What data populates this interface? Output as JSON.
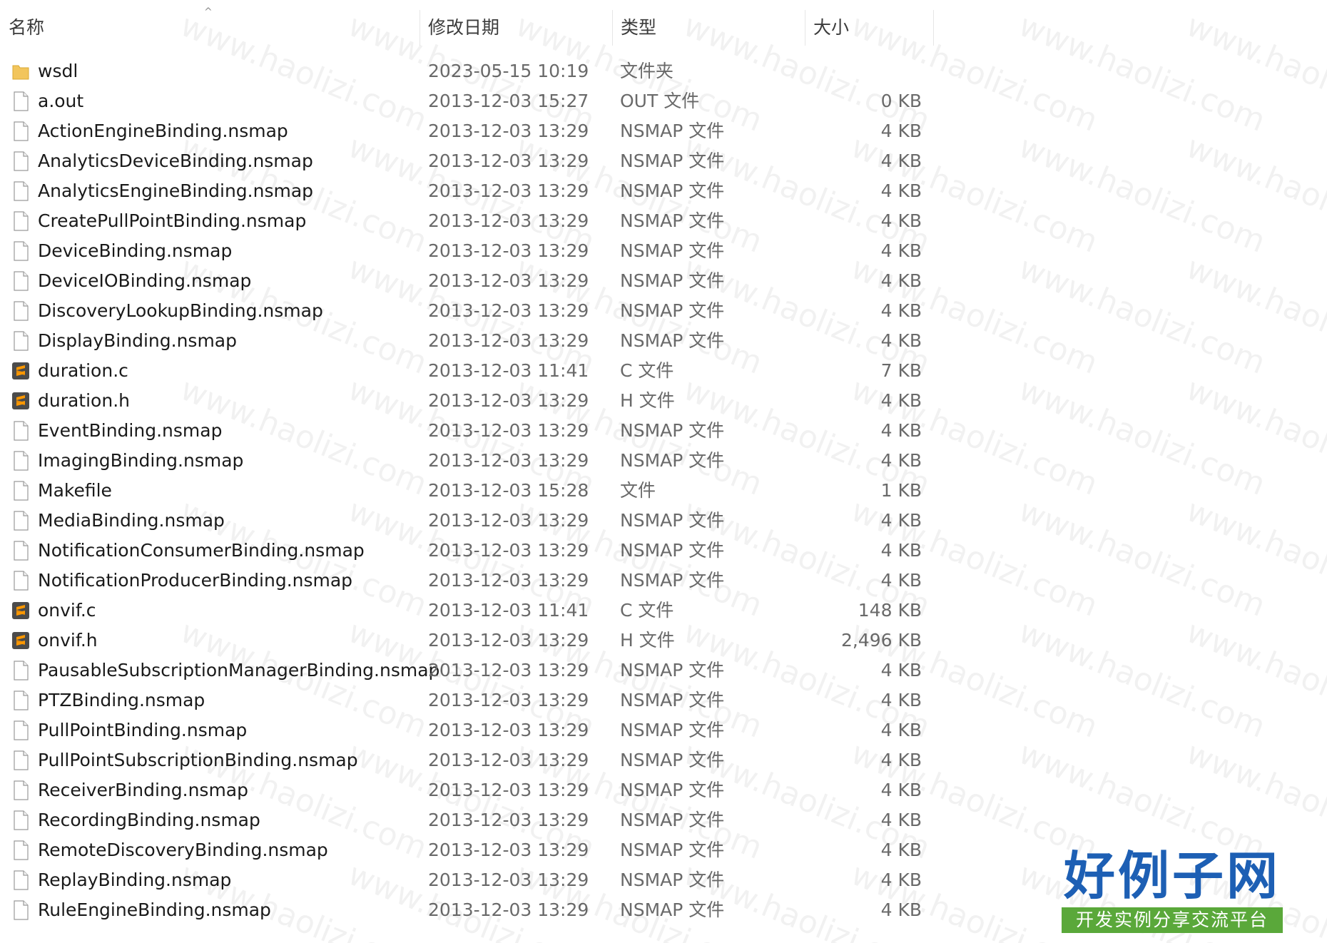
{
  "columns": {
    "name": "名称",
    "modified": "修改日期",
    "type": "类型",
    "size": "大小"
  },
  "files": [
    {
      "name": "wsdl",
      "date": "2023-05-15 10:19",
      "type": "文件夹",
      "size": "",
      "icon": "folder-icon"
    },
    {
      "name": "a.out",
      "date": "2013-12-03 15:27",
      "type": "OUT 文件",
      "size": "0 KB",
      "icon": "file-icon"
    },
    {
      "name": "ActionEngineBinding.nsmap",
      "date": "2013-12-03 13:29",
      "type": "NSMAP 文件",
      "size": "4 KB",
      "icon": "file-icon"
    },
    {
      "name": "AnalyticsDeviceBinding.nsmap",
      "date": "2013-12-03 13:29",
      "type": "NSMAP 文件",
      "size": "4 KB",
      "icon": "file-icon"
    },
    {
      "name": "AnalyticsEngineBinding.nsmap",
      "date": "2013-12-03 13:29",
      "type": "NSMAP 文件",
      "size": "4 KB",
      "icon": "file-icon"
    },
    {
      "name": "CreatePullPointBinding.nsmap",
      "date": "2013-12-03 13:29",
      "type": "NSMAP 文件",
      "size": "4 KB",
      "icon": "file-icon"
    },
    {
      "name": "DeviceBinding.nsmap",
      "date": "2013-12-03 13:29",
      "type": "NSMAP 文件",
      "size": "4 KB",
      "icon": "file-icon"
    },
    {
      "name": "DeviceIOBinding.nsmap",
      "date": "2013-12-03 13:29",
      "type": "NSMAP 文件",
      "size": "4 KB",
      "icon": "file-icon"
    },
    {
      "name": "DiscoveryLookupBinding.nsmap",
      "date": "2013-12-03 13:29",
      "type": "NSMAP 文件",
      "size": "4 KB",
      "icon": "file-icon"
    },
    {
      "name": "DisplayBinding.nsmap",
      "date": "2013-12-03 13:29",
      "type": "NSMAP 文件",
      "size": "4 KB",
      "icon": "file-icon"
    },
    {
      "name": "duration.c",
      "date": "2013-12-03 11:41",
      "type": "C 文件",
      "size": "7 KB",
      "icon": "sublime-text-icon"
    },
    {
      "name": "duration.h",
      "date": "2013-12-03 13:29",
      "type": "H 文件",
      "size": "4 KB",
      "icon": "sublime-text-icon"
    },
    {
      "name": "EventBinding.nsmap",
      "date": "2013-12-03 13:29",
      "type": "NSMAP 文件",
      "size": "4 KB",
      "icon": "file-icon"
    },
    {
      "name": "ImagingBinding.nsmap",
      "date": "2013-12-03 13:29",
      "type": "NSMAP 文件",
      "size": "4 KB",
      "icon": "file-icon"
    },
    {
      "name": "Makefile",
      "date": "2013-12-03 15:28",
      "type": "文件",
      "size": "1 KB",
      "icon": "file-icon"
    },
    {
      "name": "MediaBinding.nsmap",
      "date": "2013-12-03 13:29",
      "type": "NSMAP 文件",
      "size": "4 KB",
      "icon": "file-icon"
    },
    {
      "name": "NotificationConsumerBinding.nsmap",
      "date": "2013-12-03 13:29",
      "type": "NSMAP 文件",
      "size": "4 KB",
      "icon": "file-icon"
    },
    {
      "name": "NotificationProducerBinding.nsmap",
      "date": "2013-12-03 13:29",
      "type": "NSMAP 文件",
      "size": "4 KB",
      "icon": "file-icon"
    },
    {
      "name": "onvif.c",
      "date": "2013-12-03 11:41",
      "type": "C 文件",
      "size": "148 KB",
      "icon": "sublime-text-icon"
    },
    {
      "name": "onvif.h",
      "date": "2013-12-03 13:29",
      "type": "H 文件",
      "size": "2,496 KB",
      "icon": "sublime-text-icon"
    },
    {
      "name": "PausableSubscriptionManagerBinding.nsmap",
      "date": "2013-12-03 13:29",
      "type": "NSMAP 文件",
      "size": "4 KB",
      "icon": "file-icon"
    },
    {
      "name": "PTZBinding.nsmap",
      "date": "2013-12-03 13:29",
      "type": "NSMAP 文件",
      "size": "4 KB",
      "icon": "file-icon"
    },
    {
      "name": "PullPointBinding.nsmap",
      "date": "2013-12-03 13:29",
      "type": "NSMAP 文件",
      "size": "4 KB",
      "icon": "file-icon"
    },
    {
      "name": "PullPointSubscriptionBinding.nsmap",
      "date": "2013-12-03 13:29",
      "type": "NSMAP 文件",
      "size": "4 KB",
      "icon": "file-icon"
    },
    {
      "name": "ReceiverBinding.nsmap",
      "date": "2013-12-03 13:29",
      "type": "NSMAP 文件",
      "size": "4 KB",
      "icon": "file-icon"
    },
    {
      "name": "RecordingBinding.nsmap",
      "date": "2013-12-03 13:29",
      "type": "NSMAP 文件",
      "size": "4 KB",
      "icon": "file-icon"
    },
    {
      "name": "RemoteDiscoveryBinding.nsmap",
      "date": "2013-12-03 13:29",
      "type": "NSMAP 文件",
      "size": "4 KB",
      "icon": "file-icon"
    },
    {
      "name": "ReplayBinding.nsmap",
      "date": "2013-12-03 13:29",
      "type": "NSMAP 文件",
      "size": "4 KB",
      "icon": "file-icon"
    },
    {
      "name": "RuleEngineBinding.nsmap",
      "date": "2013-12-03 13:29",
      "type": "NSMAP 文件",
      "size": "4 KB",
      "icon": "file-icon"
    }
  ],
  "watermark": "www.haolizi.com",
  "logo": {
    "title": "好例子网",
    "subtitle": "开发实例分享交流平台"
  },
  "colors": {
    "folder": "#f2c55c",
    "sublime_bg": "#4b4b4b",
    "sublime_accent": "#ff9800",
    "logo_blue": "#1d5fb4",
    "logo_green": "#5aa83a"
  }
}
